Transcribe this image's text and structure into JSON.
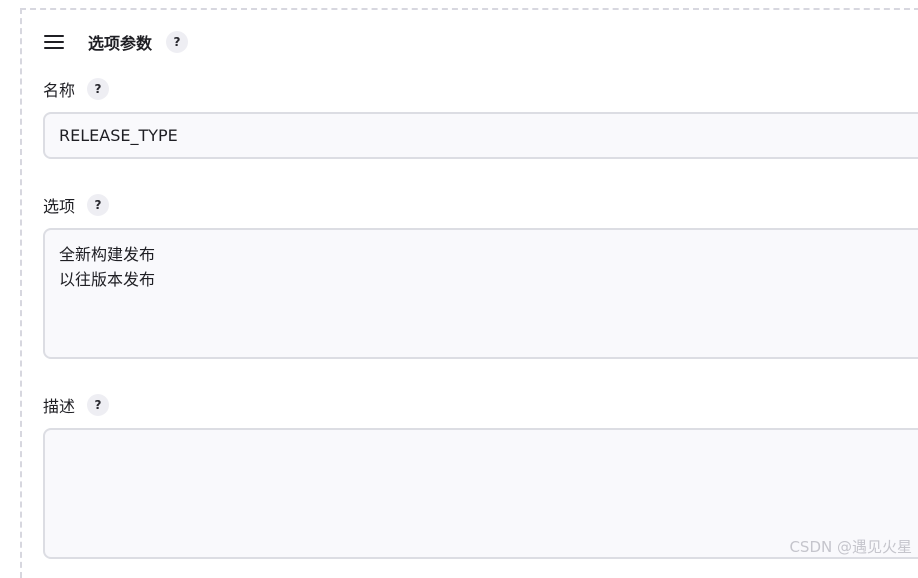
{
  "section": {
    "title": "选项参数",
    "help": "?"
  },
  "name_field": {
    "label": "名称",
    "help": "?",
    "value": "RELEASE_TYPE"
  },
  "choices_field": {
    "label": "选项",
    "help": "?",
    "value": "全新构建发布\n以往版本发布"
  },
  "description_field": {
    "label": "描述",
    "help": "?",
    "value": ""
  },
  "watermark": "CSDN @遇见火星",
  "colors": {
    "input_background": "#f9f9fc",
    "input_border": "#dcdde3",
    "help_badge": "#eeeef3",
    "dashed_frame": "#d7d7df"
  },
  "icons": {
    "drag_handle": "drag-handle-icon",
    "help": "help-icon"
  }
}
